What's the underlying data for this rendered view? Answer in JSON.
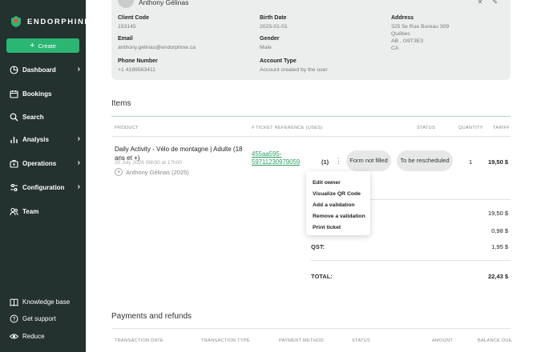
{
  "sidebar": {
    "brand": "ENDORPHINE",
    "create_label": "Create",
    "items": [
      {
        "label": "Dashboard",
        "icon": "pie-chart-icon",
        "chevron": true
      },
      {
        "label": "Bookings",
        "icon": "calendar-icon",
        "chevron": false
      },
      {
        "label": "Search",
        "icon": "search-icon",
        "chevron": false
      },
      {
        "label": "Analysis",
        "icon": "bar-chart-icon",
        "chevron": true
      },
      {
        "label": "Operations",
        "icon": "operations-icon",
        "chevron": true
      },
      {
        "label": "Configuration",
        "icon": "sliders-icon",
        "chevron": true
      },
      {
        "label": "Team",
        "icon": "team-icon",
        "chevron": false
      }
    ],
    "bottom": [
      {
        "label": "Knowledge base",
        "icon": "book-icon"
      },
      {
        "label": "Get support",
        "icon": "help-icon"
      },
      {
        "label": "Reduce",
        "icon": "eye-icon"
      }
    ]
  },
  "customer": {
    "name": "Anthony Gélinas",
    "client_code_label": "Client Code",
    "client_code": "153145",
    "birth_date_label": "Birth Date",
    "birth_date": "2025-01-01",
    "address_label": "Address",
    "address_line1": "325 5e Rue Bureau 309",
    "address_line2": "Québec",
    "address_line3": "AB , G9T3E3",
    "address_line4": "CA",
    "email_label": "Email",
    "email": "anthony.gelinas@endorphine.ca",
    "gender_label": "Gender",
    "gender": "Male",
    "phone_label": "Phone Number",
    "phone": "+1 4189563411",
    "account_type_label": "Account Type",
    "account_type": "Account created by the user"
  },
  "items": {
    "title": "Items",
    "headers": {
      "product": "PRODUCT",
      "ticket_ref": "# TICKET REFERENCE (USES)",
      "status": "STATUS",
      "quantity": "QUANTITY",
      "tariff": "TARIFF"
    },
    "row": {
      "product_name": "Daily Activity - Vélo de montagne | Adulte (18 ans et +)",
      "date": "30 July 2026 08h30 at 17h00",
      "person": "Anthony Gélinas (2025)",
      "ticket_ref": "455aa595-59711230979059",
      "uses": "(1)",
      "form_status": "Form not filled",
      "schedule_status": "To be rescheduled",
      "quantity": "1",
      "tariff": "19,50 $"
    },
    "menu": [
      "Edit owner",
      "Visualize QR Code",
      "Add a validation",
      "Remove a validation",
      "Print ticket"
    ],
    "totals": {
      "subtotal": "19,50 $",
      "gst": "0,98 $",
      "qst_label": "QST:",
      "qst": "1,95 $",
      "total_label": "TOTAL:",
      "total": "22,43 $"
    }
  },
  "payments": {
    "title": "Payments and refunds",
    "headers": [
      "TRANSACTION DATE",
      "TRANSACTION TYPE",
      "PAYMENT METHOD",
      "STATUS",
      "AMOUNT",
      "BALANCE DUE"
    ]
  }
}
